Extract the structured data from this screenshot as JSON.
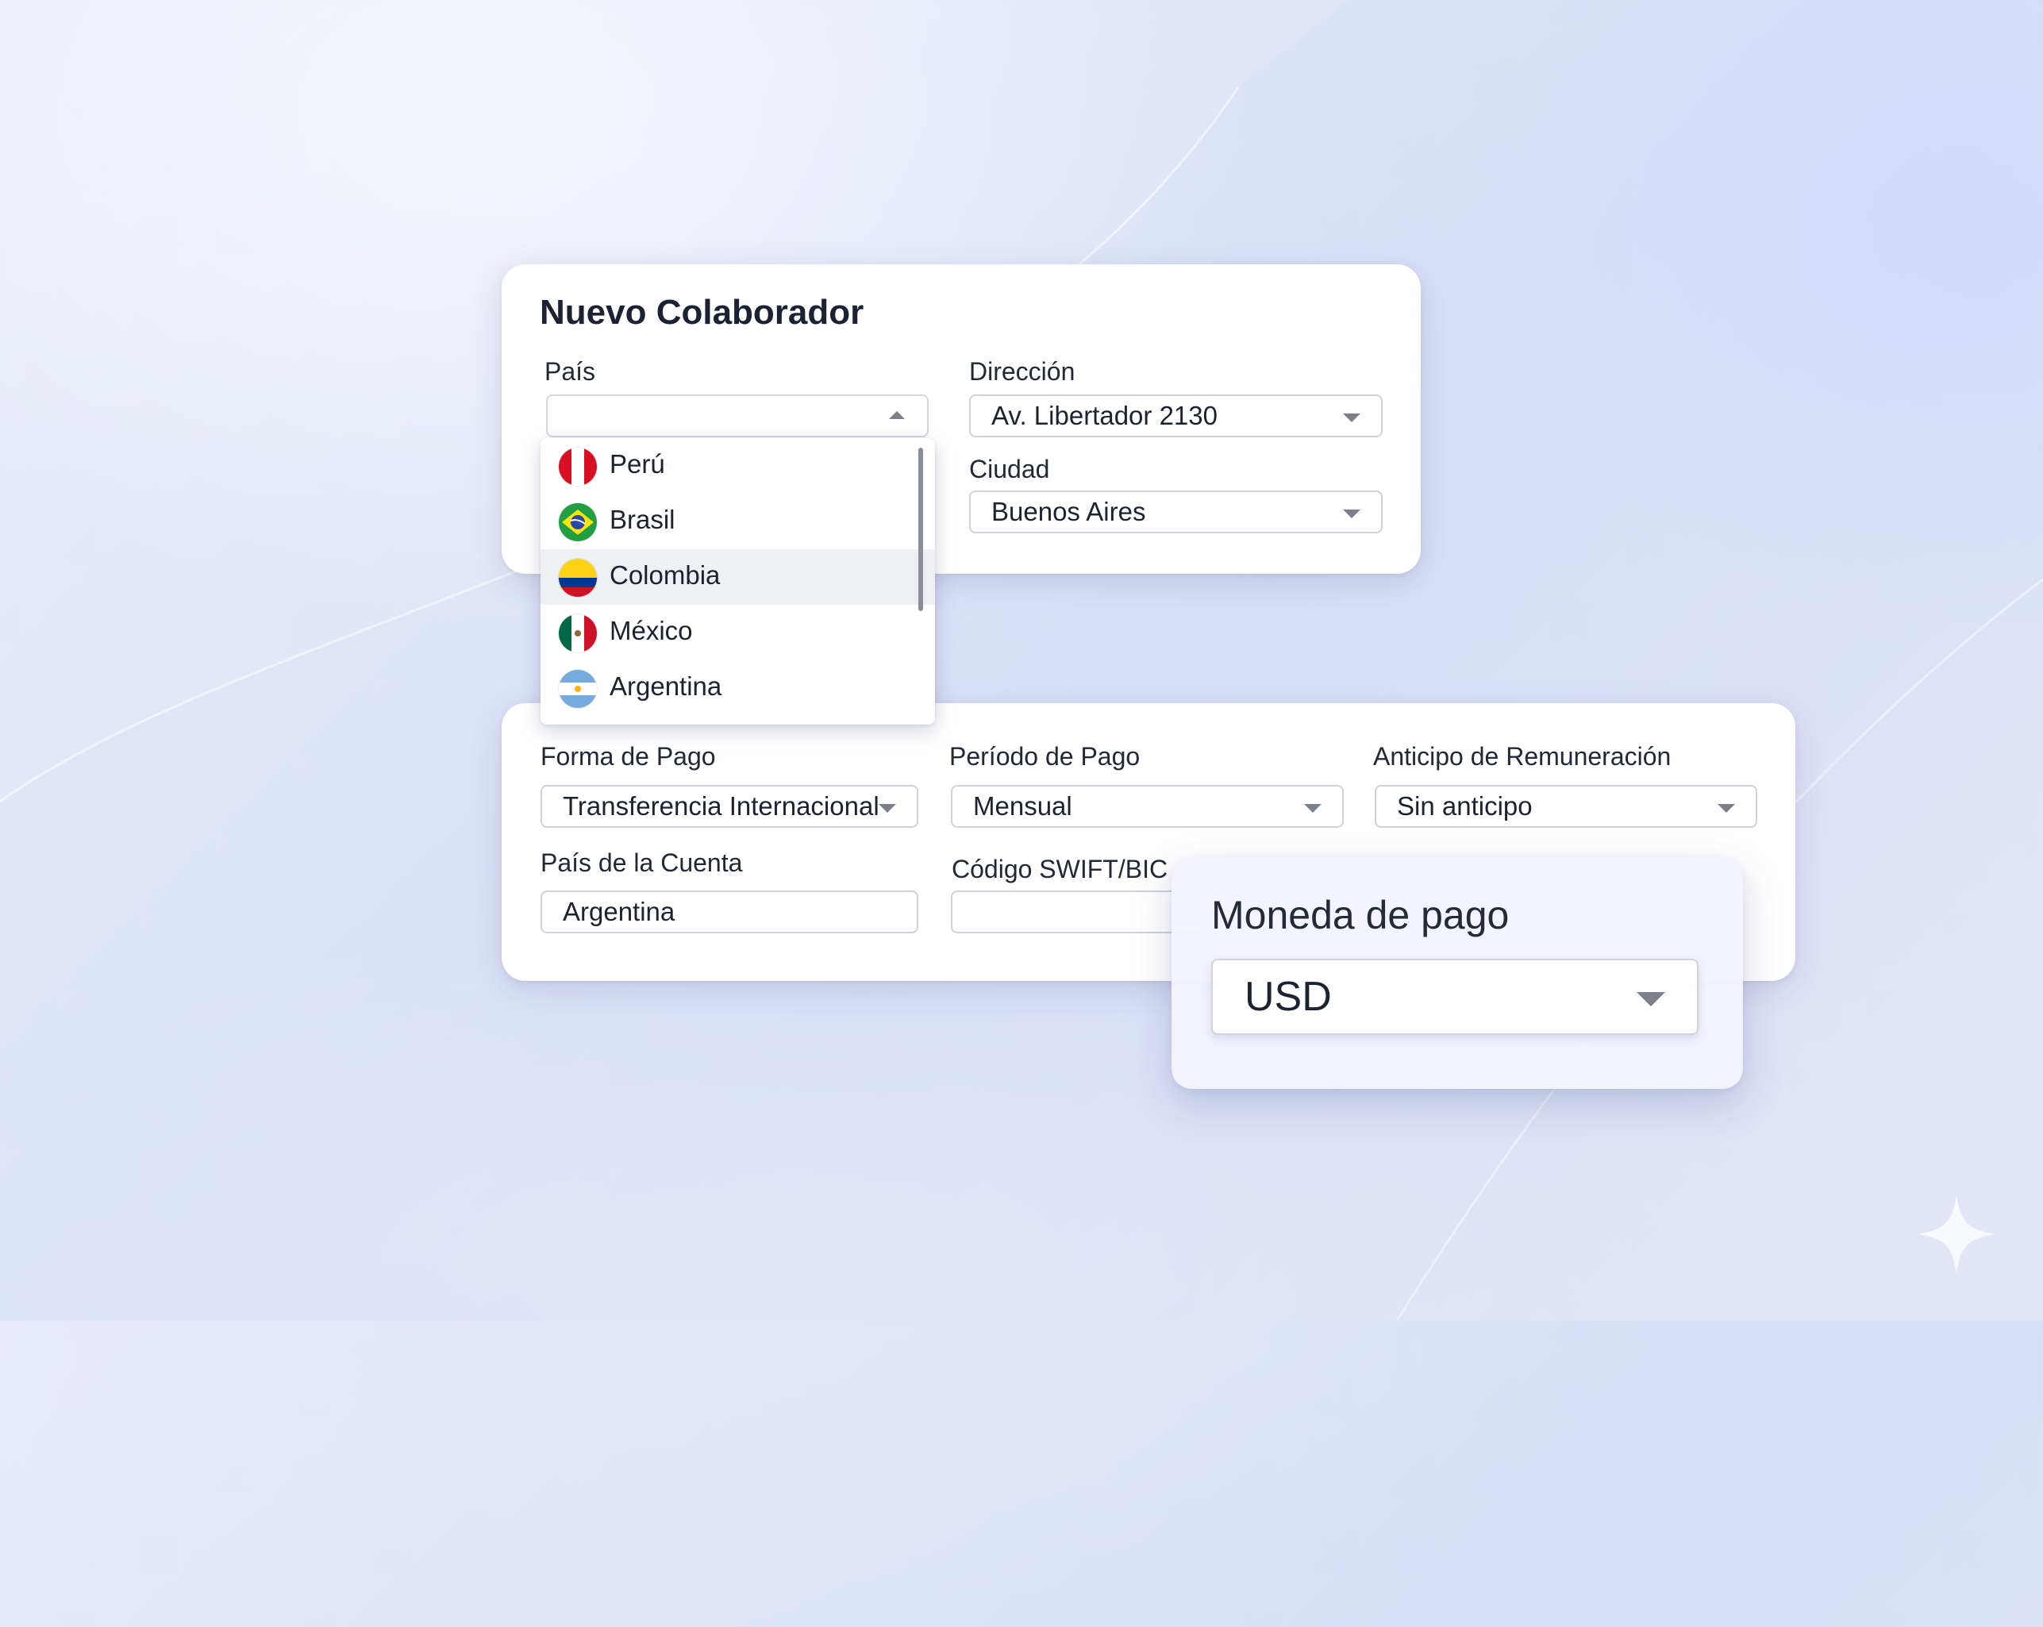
{
  "form": {
    "title": "Nuevo Colaborador",
    "pais": {
      "label": "País",
      "value": "",
      "options": [
        {
          "label": "Perú",
          "flag": "peru-flag-icon",
          "selected": false
        },
        {
          "label": "Brasil",
          "flag": "brazil-flag-icon",
          "selected": false
        },
        {
          "label": "Colombia",
          "flag": "colombia-flag-icon",
          "selected": true
        },
        {
          "label": "México",
          "flag": "mexico-flag-icon",
          "selected": false
        },
        {
          "label": "Argentina",
          "flag": "argentina-flag-icon",
          "selected": false
        }
      ]
    },
    "direccion": {
      "label": "Dirección",
      "value": "Av. Libertador 2130"
    },
    "ciudad": {
      "label": "Ciudad",
      "value": "Buenos Aires"
    }
  },
  "payment": {
    "forma_de_pago": {
      "label": "Forma de Pago",
      "value": "Transferencia Internacional"
    },
    "periodo_de_pago": {
      "label": "Período de Pago",
      "value": "Mensual"
    },
    "anticipo": {
      "label": "Anticipo de Remuneración",
      "value": "Sin anticipo"
    },
    "pais_cuenta": {
      "label": "País de la Cuenta",
      "value": "Argentina"
    },
    "swift": {
      "label": "Código SWIFT/BIC",
      "value": ""
    }
  },
  "moneda": {
    "title": "Moneda de pago",
    "value": "USD"
  },
  "colors": {
    "accent_text": "#1b2233",
    "border": "#cdd1d9",
    "selected_row": "#eef0f4",
    "background": "#dfe5f7"
  }
}
